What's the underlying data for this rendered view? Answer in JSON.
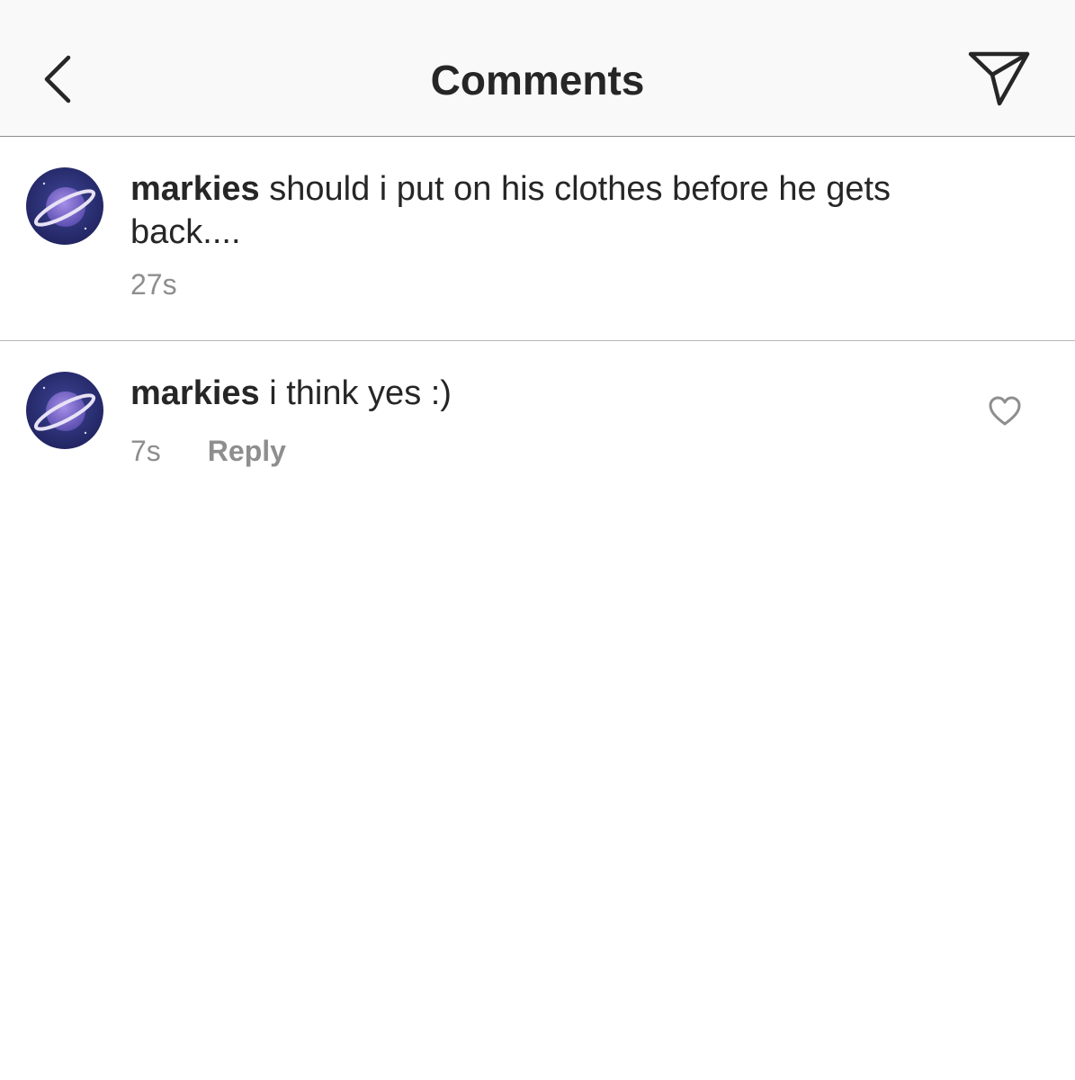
{
  "header": {
    "title": "Comments",
    "back_icon": "chevron-left-icon",
    "share_icon": "paper-plane-icon"
  },
  "comments": [
    {
      "username": "markies",
      "text": " should i put on his clothes before he gets back....",
      "time": "27s"
    },
    {
      "username": "markies",
      "text": " i think yes :)",
      "time": "7s",
      "reply_label": "Reply",
      "like_icon": "heart-outline-icon"
    }
  ],
  "colors": {
    "header_bg": "#f9f9f9",
    "text": "#262626",
    "secondary_text": "#8e8e8e",
    "avatar_bg": "#2c2e78"
  }
}
